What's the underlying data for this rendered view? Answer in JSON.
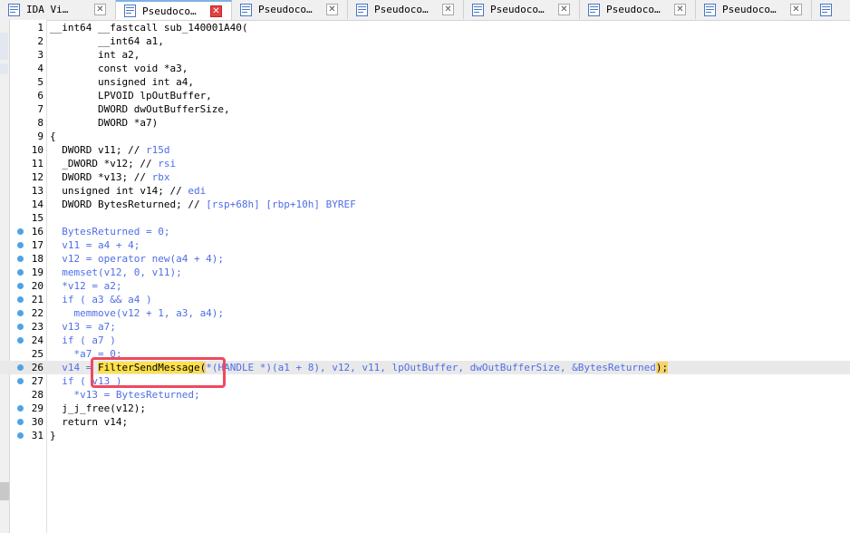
{
  "tabs": [
    {
      "label": "IDA Vi…",
      "active": false
    },
    {
      "label": "Pseudoco…",
      "active": true
    },
    {
      "label": "Pseudoco…",
      "active": false
    },
    {
      "label": "Pseudoco…",
      "active": false
    },
    {
      "label": "Pseudoco…",
      "active": false
    },
    {
      "label": "Pseudoco…",
      "active": false
    },
    {
      "label": "Pseudoco…",
      "active": false
    }
  ],
  "close_glyph": "✕",
  "code": {
    "l1": "__int64 __fastcall sub_140001A40(",
    "l2": "        __int64 a1,",
    "l3": "        int a2,",
    "l4": "        const void *a3,",
    "l5": "        unsigned int a4,",
    "l6": "        LPVOID lpOutBuffer,",
    "l7": "        DWORD dwOutBufferSize,",
    "l8": "        DWORD *a7)",
    "l9": "{",
    "l10a": "  DWORD v11; // ",
    "l10b": "r15d",
    "l11a": "  _DWORD *v12; // ",
    "l11b": "rsi",
    "l12a": "  DWORD *v13; // ",
    "l12b": "rbx",
    "l13a": "  unsigned int v14; // ",
    "l13b": "edi",
    "l14a": "  DWORD BytesReturned; // ",
    "l14b": "[rsp+68h] [rbp+10h] BYREF",
    "l16": "  BytesReturned = 0;",
    "l17": "  v11 = a4 + 4;",
    "l18": "  v12 = operator new(a4 + 4);",
    "l19": "  memset(v12, 0, v11);",
    "l20": "  *v12 = a2;",
    "l21": "  if ( a3 && a4 )",
    "l22": "    memmove(v12 + 1, a3, a4);",
    "l23": "  v13 = a7;",
    "l24": "  if ( a7 )",
    "l25": "    *a7 = 0;",
    "l26a": "  v14 = ",
    "l26fn": "FilterSendMessage",
    "l26b": "(",
    "l26c": "*(HANDLE *)(a1 + 8), v12, v11, lpOutBuffer, dwOutBufferSize, &BytesReturned",
    "l26d": ");",
    "l27": "  if ( v13 )",
    "l28": "    *v13 = BytesReturned;",
    "l29": "  j_j_free(v12);",
    "l30": "  return v14;",
    "l31": "}"
  },
  "line_numbers": [
    "1",
    "2",
    "3",
    "4",
    "5",
    "6",
    "7",
    "8",
    "9",
    "10",
    "11",
    "12",
    "13",
    "14",
    "15",
    "16",
    "17",
    "18",
    "19",
    "20",
    "21",
    "22",
    "23",
    "24",
    "25",
    "26",
    "27",
    "28",
    "29",
    "30",
    "31"
  ],
  "colors": {
    "variable": "#4d6ee8",
    "highlight": "#ffe14a",
    "annotation": "#f0495e",
    "breakpoint_dot": "#4ea3e6"
  }
}
